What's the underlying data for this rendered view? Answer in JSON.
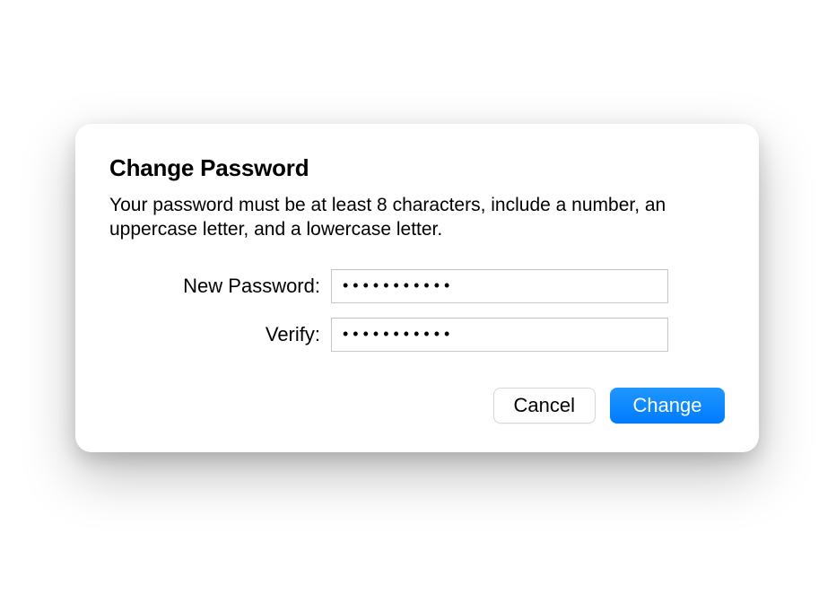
{
  "dialog": {
    "title": "Change Password",
    "description": "Your password must be at least 8 characters, include a number, an uppercase letter, and a lowercase letter.",
    "fields": {
      "new_password": {
        "label": "New Password:",
        "value": "●●●●●●●●●●●"
      },
      "verify": {
        "label": "Verify:",
        "value": "●●●●●●●●●●●"
      }
    },
    "buttons": {
      "cancel": "Cancel",
      "change": "Change"
    }
  }
}
